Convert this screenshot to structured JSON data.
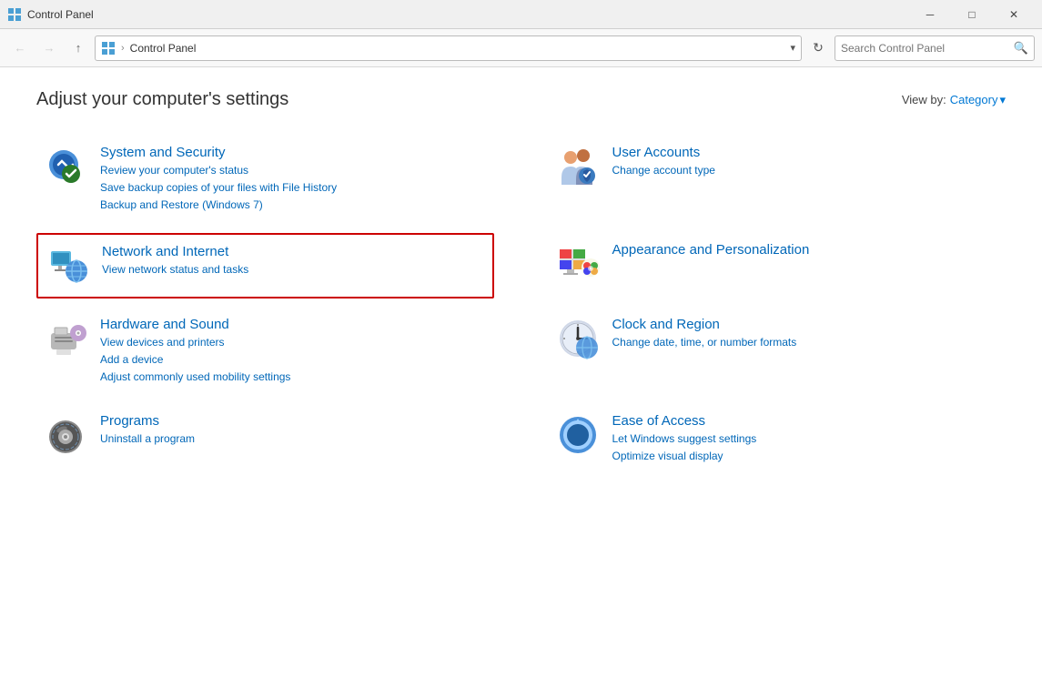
{
  "window": {
    "title": "Control Panel",
    "icon": "control-panel-icon"
  },
  "titlebar": {
    "minimize_label": "─",
    "maximize_label": "□",
    "close_label": "✕"
  },
  "addressbar": {
    "back_label": "←",
    "forward_label": "→",
    "up_label": "↑",
    "breadcrumb_icon": "control-panel-icon",
    "breadcrumb_separator": "›",
    "breadcrumb_text": "Control Panel",
    "dropdown_label": "▾",
    "refresh_label": "↻",
    "search_placeholder": "Search Control Panel",
    "search_icon_label": "🔍"
  },
  "main": {
    "page_title": "Adjust your computer's settings",
    "view_by_label": "View by:",
    "view_by_value": "Category",
    "view_by_dropdown": "▾"
  },
  "categories": [
    {
      "id": "system-security",
      "title": "System and Security",
      "links": [
        "Review your computer's status",
        "Save backup copies of your files with File History",
        "Backup and Restore (Windows 7)"
      ],
      "highlighted": false
    },
    {
      "id": "user-accounts",
      "title": "User Accounts",
      "links": [
        "Change account type"
      ],
      "highlighted": false
    },
    {
      "id": "network-internet",
      "title": "Network and Internet",
      "links": [
        "View network status and tasks"
      ],
      "highlighted": true
    },
    {
      "id": "appearance-personalization",
      "title": "Appearance and Personalization",
      "links": [],
      "highlighted": false
    },
    {
      "id": "hardware-sound",
      "title": "Hardware and Sound",
      "links": [
        "View devices and printers",
        "Add a device",
        "Adjust commonly used mobility settings"
      ],
      "highlighted": false
    },
    {
      "id": "clock-region",
      "title": "Clock and Region",
      "links": [
        "Change date, time, or number formats"
      ],
      "highlighted": false
    },
    {
      "id": "programs",
      "title": "Programs",
      "links": [
        "Uninstall a program"
      ],
      "highlighted": false
    },
    {
      "id": "ease-of-access",
      "title": "Ease of Access",
      "links": [
        "Let Windows suggest settings",
        "Optimize visual display"
      ],
      "highlighted": false
    }
  ]
}
